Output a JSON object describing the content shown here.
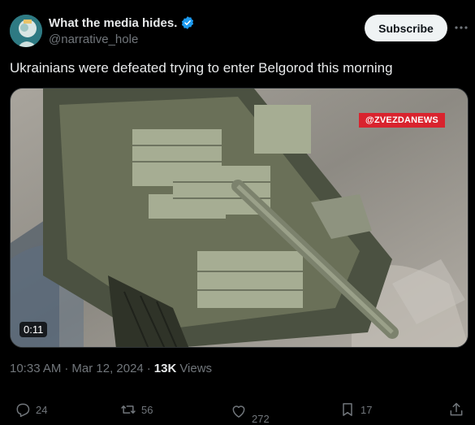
{
  "author": {
    "display_name": "What the media hides.",
    "handle": "@narrative_hole",
    "avatar_icon": "avatar-icon",
    "verified_color": "#1d9bf0"
  },
  "subscribe_label": "Subscribe",
  "tweet": {
    "text": "Ukrainians were defeated trying to enter Belgorod this morning"
  },
  "media": {
    "watermark": "@ZVEZDANEWS",
    "duration": "0:11"
  },
  "meta": {
    "time": "10:33 AM",
    "date": "Mar 12, 2024",
    "views_count": "13K",
    "views_label": "Views"
  },
  "actions": {
    "replies": "24",
    "reposts": "56",
    "likes": "272",
    "bookmarks": "17"
  },
  "colors": {
    "background": "#000000",
    "text": "#e7e9ea",
    "muted": "#71767b",
    "accent": "#1d9bf0",
    "watermark_red": "#d9232e"
  }
}
